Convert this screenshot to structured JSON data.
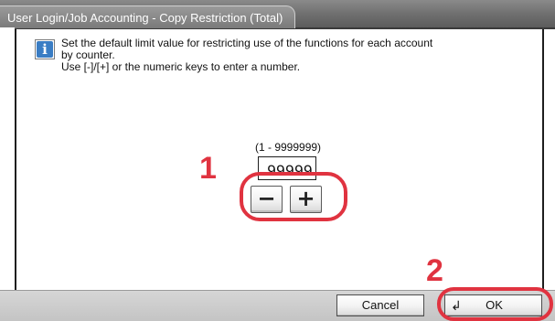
{
  "window": {
    "title": "User Login/Job Accounting - Copy Restriction (Total)"
  },
  "message": {
    "icon": "info-icon",
    "line1": "Set the default limit value for restricting use of the functions for each account",
    "line2": "by counter.",
    "line3": "Use [-]/[+] or the numeric keys to enter a number."
  },
  "limit": {
    "range_label": "(1 - 9999999)",
    "value": "99999",
    "decrement_label": "−",
    "increment_label": "+"
  },
  "callouts": {
    "step1": "1",
    "step2": "2"
  },
  "footer": {
    "cancel_label": "Cancel",
    "ok_label": "OK",
    "ok_icon": "enter-icon",
    "ok_icon_glyph": "↲"
  },
  "colors": {
    "callout_red": "#e03340",
    "info_blue": "#3a7dc4",
    "title_gray": "#707070"
  }
}
